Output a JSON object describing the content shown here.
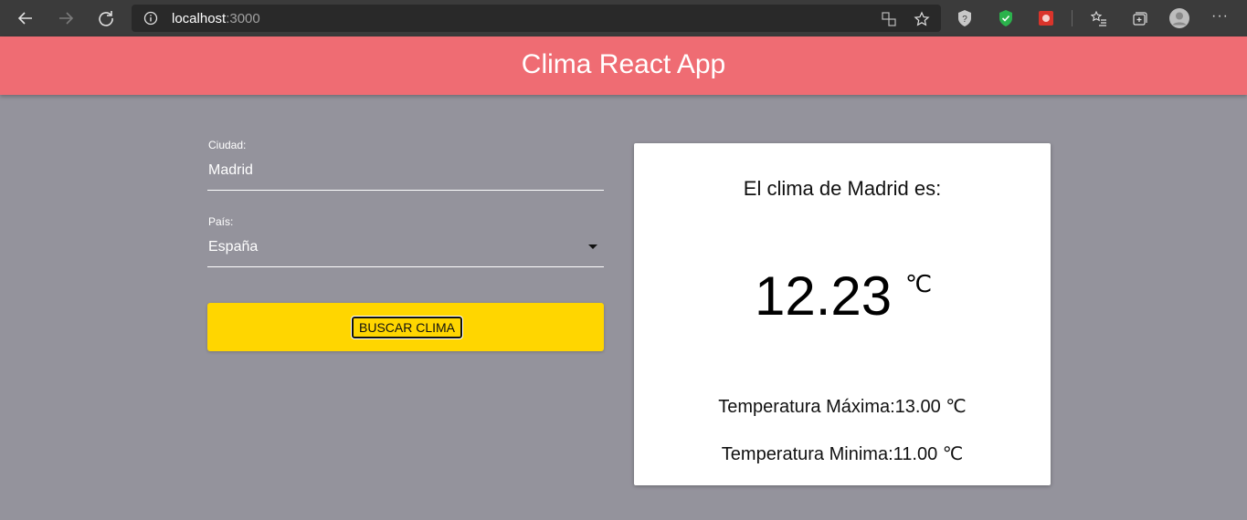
{
  "browser": {
    "url_host": "localhost",
    "url_port": ":3000",
    "more_label": "···"
  },
  "app": {
    "title": "Clima React App"
  },
  "form": {
    "city_label": "Ciudad:",
    "city_value": "Madrid",
    "country_label": "País:",
    "country_value": "España",
    "search_button": "BUSCAR CLIMA"
  },
  "result": {
    "heading": "El clima de Madrid es:",
    "temperature": "12.23",
    "unit": "℃",
    "max_text": "Temperatura Máxima:13.00 ℃",
    "min_text": "Temperatura Minima:11.00 ℃"
  },
  "colors": {
    "header": "#ef6c73",
    "background": "#94939c",
    "button": "#ffd600"
  }
}
